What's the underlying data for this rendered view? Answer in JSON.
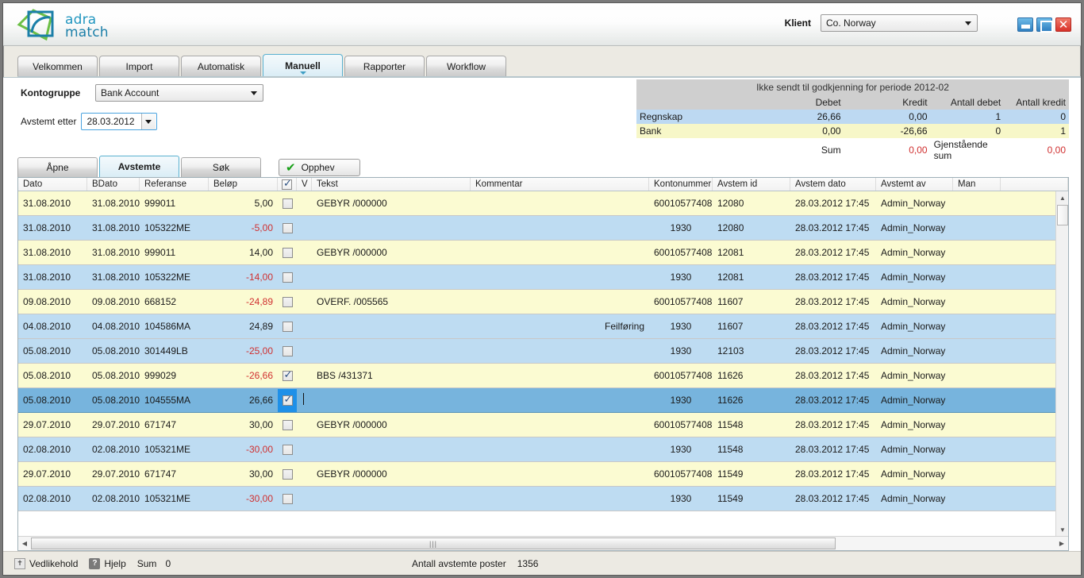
{
  "titlebar": {
    "logo_line1": "adra",
    "logo_line2": "match",
    "client_label": "Klient",
    "client_value": "Co. Norway",
    "minimize": "_",
    "maximize": "□",
    "close": "✕"
  },
  "tabs": [
    {
      "label": "Velkommen",
      "active": false
    },
    {
      "label": "Import",
      "active": false
    },
    {
      "label": "Automatisk",
      "active": false
    },
    {
      "label": "Manuell",
      "active": true
    },
    {
      "label": "Rapporter",
      "active": false
    },
    {
      "label": "Workflow",
      "active": false
    }
  ],
  "filters": {
    "kontogruppe_label": "Kontogruppe",
    "kontogruppe_value": "Bank Account",
    "avstemt_label": "Avstemt etter",
    "avstemt_value": "28.03.2012"
  },
  "summary": {
    "title": "Ikke sendt til godkjenning for periode 2012-02",
    "headers": [
      "",
      "Debet",
      "Kredit",
      "Antall debet",
      "Antall kredit"
    ],
    "rows": [
      {
        "label": "Regnskap",
        "debet": "26,66",
        "kredit": "0,00",
        "antall_debet": "1",
        "antall_kredit": "0"
      },
      {
        "label": "Bank",
        "debet": "0,00",
        "kredit": "-26,66",
        "antall_debet": "0",
        "antall_kredit": "1"
      }
    ],
    "sum_label": "Sum",
    "sum_value": "0,00",
    "gjenstaende_label": "Gjenstående sum",
    "gjenstaende_value": "0,00"
  },
  "subtabs": [
    {
      "label": "Åpne",
      "active": false
    },
    {
      "label": "Avstemte",
      "active": true
    },
    {
      "label": "Søk",
      "active": false
    }
  ],
  "opphev_button": "Opphev",
  "grid": {
    "columns": [
      "Dato",
      "BDato",
      "Referanse",
      "Beløp",
      "",
      "V",
      "Tekst",
      "Kommentar",
      "Kontonummer",
      "Avstem id",
      "Avstem dato",
      "Avstemt av",
      "Man",
      ""
    ],
    "rows": [
      {
        "dato": "31.08.2010",
        "bdato": "31.08.2010",
        "referanse": "999011",
        "belop": "5,00",
        "negative": false,
        "checked": false,
        "tekst": "GEBYR  /000000",
        "kommentar": "",
        "kontonummer": "60010577408",
        "avstem_id": "12080",
        "avstem_dato": "28.03.2012 17:45",
        "avstemt_av": "Admin_Norway",
        "man": "",
        "style": "even"
      },
      {
        "dato": "31.08.2010",
        "bdato": "31.08.2010",
        "referanse": "105322ME",
        "belop": "-5,00",
        "negative": true,
        "checked": false,
        "tekst": "",
        "kommentar": "",
        "kontonummer": "1930",
        "avstem_id": "12080",
        "avstem_dato": "28.03.2012 17:45",
        "avstemt_av": "Admin_Norway",
        "man": "",
        "style": "odd"
      },
      {
        "dato": "31.08.2010",
        "bdato": "31.08.2010",
        "referanse": "999011",
        "belop": "14,00",
        "negative": false,
        "checked": false,
        "tekst": "GEBYR  /000000",
        "kommentar": "",
        "kontonummer": "60010577408",
        "avstem_id": "12081",
        "avstem_dato": "28.03.2012 17:45",
        "avstemt_av": "Admin_Norway",
        "man": "",
        "style": "even"
      },
      {
        "dato": "31.08.2010",
        "bdato": "31.08.2010",
        "referanse": "105322ME",
        "belop": "-14,00",
        "negative": true,
        "checked": false,
        "tekst": "",
        "kommentar": "",
        "kontonummer": "1930",
        "avstem_id": "12081",
        "avstem_dato": "28.03.2012 17:45",
        "avstemt_av": "Admin_Norway",
        "man": "",
        "style": "odd"
      },
      {
        "dato": "09.08.2010",
        "bdato": "09.08.2010",
        "referanse": "668152",
        "belop": "-24,89",
        "negative": true,
        "checked": false,
        "tekst": "OVERF. /005565",
        "kommentar": "",
        "kontonummer": "60010577408",
        "avstem_id": "11607",
        "avstem_dato": "28.03.2012 17:45",
        "avstemt_av": "Admin_Norway",
        "man": "",
        "style": "even"
      },
      {
        "dato": "04.08.2010",
        "bdato": "04.08.2010",
        "referanse": "104586MA",
        "belop": "24,89",
        "negative": false,
        "checked": false,
        "tekst": "",
        "kommentar": "Feilføring",
        "kontonummer": "1930",
        "avstem_id": "11607",
        "avstem_dato": "28.03.2012 17:45",
        "avstemt_av": "Admin_Norway",
        "man": "",
        "style": "odd"
      },
      {
        "dato": "05.08.2010",
        "bdato": "05.08.2010",
        "referanse": "301449LB",
        "belop": "-25,00",
        "negative": true,
        "checked": false,
        "tekst": "",
        "kommentar": "",
        "kontonummer": "1930",
        "avstem_id": "12103",
        "avstem_dato": "28.03.2012 17:45",
        "avstemt_av": "Admin_Norway",
        "man": "",
        "style": "odd"
      },
      {
        "dato": "05.08.2010",
        "bdato": "05.08.2010",
        "referanse": "999029",
        "belop": "-26,66",
        "negative": true,
        "checked": true,
        "tekst": "BBS    /431371",
        "kommentar": "",
        "kontonummer": "60010577408",
        "avstem_id": "11626",
        "avstem_dato": "28.03.2012 17:45",
        "avstemt_av": "Admin_Norway",
        "man": "",
        "style": "even"
      },
      {
        "dato": "05.08.2010",
        "bdato": "05.08.2010",
        "referanse": "104555MA",
        "belop": "26,66",
        "negative": false,
        "checked": true,
        "tekst": "",
        "kommentar": "",
        "kontonummer": "1930",
        "avstem_id": "11626",
        "avstem_dato": "28.03.2012 17:45",
        "avstemt_av": "Admin_Norway",
        "man": "",
        "style": "sel"
      },
      {
        "dato": "29.07.2010",
        "bdato": "29.07.2010",
        "referanse": "671747",
        "belop": "30,00",
        "negative": false,
        "checked": false,
        "tekst": "GEBYR  /000000",
        "kommentar": "",
        "kontonummer": "60010577408",
        "avstem_id": "11548",
        "avstem_dato": "28.03.2012 17:45",
        "avstemt_av": "Admin_Norway",
        "man": "",
        "style": "even"
      },
      {
        "dato": "02.08.2010",
        "bdato": "02.08.2010",
        "referanse": "105321ME",
        "belop": "-30,00",
        "negative": true,
        "checked": false,
        "tekst": "",
        "kommentar": "",
        "kontonummer": "1930",
        "avstem_id": "11548",
        "avstem_dato": "28.03.2012 17:45",
        "avstemt_av": "Admin_Norway",
        "man": "",
        "style": "odd"
      },
      {
        "dato": "29.07.2010",
        "bdato": "29.07.2010",
        "referanse": "671747",
        "belop": "30,00",
        "negative": false,
        "checked": false,
        "tekst": "GEBYR  /000000",
        "kommentar": "",
        "kontonummer": "60010577408",
        "avstem_id": "11549",
        "avstem_dato": "28.03.2012 17:45",
        "avstemt_av": "Admin_Norway",
        "man": "",
        "style": "even"
      },
      {
        "dato": "02.08.2010",
        "bdato": "02.08.2010",
        "referanse": "105321ME",
        "belop": "-30,00",
        "negative": true,
        "checked": false,
        "tekst": "",
        "kommentar": "",
        "kontonummer": "1930",
        "avstem_id": "11549",
        "avstem_dato": "28.03.2012 17:45",
        "avstemt_av": "Admin_Norway",
        "man": "",
        "style": "odd"
      }
    ]
  },
  "statusbar": {
    "vedlikehold": "Vedlikehold",
    "hjelp": "Hjelp",
    "sum_label": "Sum",
    "sum_value": "0",
    "antall_label": "Antall avstemte poster",
    "antall_value": "1356"
  },
  "colors": {
    "accent": "#59b0cf",
    "row_even": "#fbfbd2",
    "row_odd": "#bedcf2",
    "row_selected": "#77b4dd",
    "negative": "#d03030"
  }
}
